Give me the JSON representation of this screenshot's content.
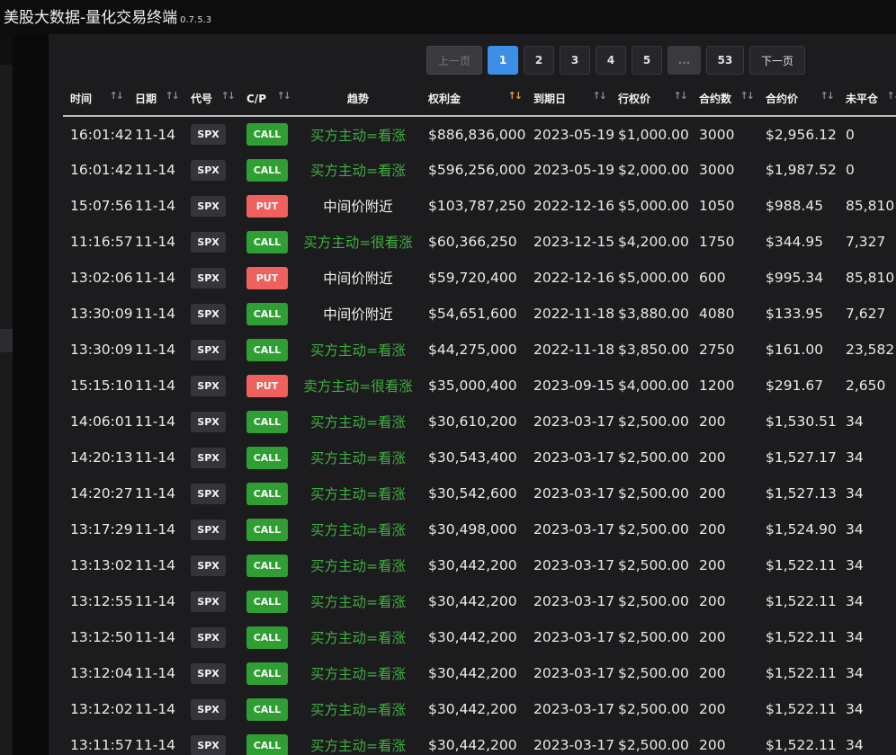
{
  "app": {
    "title": "美股大数据-量化交易终端",
    "version": "0.7.5.3"
  },
  "pagination": {
    "prev_label": "上一页",
    "pages": [
      "1",
      "2",
      "3",
      "4",
      "5"
    ],
    "ellipsis": "...",
    "last_page": "53",
    "next_label": "下一页",
    "current": "1"
  },
  "table": {
    "columns": [
      "时间",
      "日期",
      "代号",
      "C/P",
      "趋势",
      "权利金",
      "到期日",
      "行权价",
      "合约数",
      "合约价",
      "未平仓"
    ],
    "sorted_column": "权利金",
    "rows": [
      [
        "16:01:42",
        "11-14",
        "SPX",
        "CALL",
        "买方主动=看涨",
        "$886,836,000",
        "2023-05-19",
        "$1,000.00",
        "3000",
        "$2,956.12",
        "0"
      ],
      [
        "16:01:42",
        "11-14",
        "SPX",
        "CALL",
        "买方主动=看涨",
        "$596,256,000",
        "2023-05-19",
        "$2,000.00",
        "3000",
        "$1,987.52",
        "0"
      ],
      [
        "15:07:56",
        "11-14",
        "SPX",
        "PUT",
        "中间价附近",
        "$103,787,250",
        "2022-12-16",
        "$5,000.00",
        "1050",
        "$988.45",
        "85,810"
      ],
      [
        "11:16:57",
        "11-14",
        "SPX",
        "CALL",
        "买方主动=很看涨",
        "$60,366,250",
        "2023-12-15",
        "$4,200.00",
        "1750",
        "$344.95",
        "7,327"
      ],
      [
        "13:02:06",
        "11-14",
        "SPX",
        "PUT",
        "中间价附近",
        "$59,720,400",
        "2022-12-16",
        "$5,000.00",
        "600",
        "$995.34",
        "85,810"
      ],
      [
        "13:30:09",
        "11-14",
        "SPX",
        "CALL",
        "中间价附近",
        "$54,651,600",
        "2022-11-18",
        "$3,880.00",
        "4080",
        "$133.95",
        "7,627"
      ],
      [
        "13:30:09",
        "11-14",
        "SPX",
        "CALL",
        "买方主动=看涨",
        "$44,275,000",
        "2022-11-18",
        "$3,850.00",
        "2750",
        "$161.00",
        "23,582"
      ],
      [
        "15:15:10",
        "11-14",
        "SPX",
        "PUT",
        "卖方主动=很看涨",
        "$35,000,400",
        "2023-09-15",
        "$4,000.00",
        "1200",
        "$291.67",
        "2,650"
      ],
      [
        "14:06:01",
        "11-14",
        "SPX",
        "CALL",
        "买方主动=看涨",
        "$30,610,200",
        "2023-03-17",
        "$2,500.00",
        "200",
        "$1,530.51",
        "34"
      ],
      [
        "14:20:13",
        "11-14",
        "SPX",
        "CALL",
        "买方主动=看涨",
        "$30,543,400",
        "2023-03-17",
        "$2,500.00",
        "200",
        "$1,527.17",
        "34"
      ],
      [
        "14:20:27",
        "11-14",
        "SPX",
        "CALL",
        "买方主动=看涨",
        "$30,542,600",
        "2023-03-17",
        "$2,500.00",
        "200",
        "$1,527.13",
        "34"
      ],
      [
        "13:17:29",
        "11-14",
        "SPX",
        "CALL",
        "买方主动=看涨",
        "$30,498,000",
        "2023-03-17",
        "$2,500.00",
        "200",
        "$1,524.90",
        "34"
      ],
      [
        "13:13:02",
        "11-14",
        "SPX",
        "CALL",
        "买方主动=看涨",
        "$30,442,200",
        "2023-03-17",
        "$2,500.00",
        "200",
        "$1,522.11",
        "34"
      ],
      [
        "13:12:55",
        "11-14",
        "SPX",
        "CALL",
        "买方主动=看涨",
        "$30,442,200",
        "2023-03-17",
        "$2,500.00",
        "200",
        "$1,522.11",
        "34"
      ],
      [
        "13:12:50",
        "11-14",
        "SPX",
        "CALL",
        "买方主动=看涨",
        "$30,442,200",
        "2023-03-17",
        "$2,500.00",
        "200",
        "$1,522.11",
        "34"
      ],
      [
        "13:12:04",
        "11-14",
        "SPX",
        "CALL",
        "买方主动=看涨",
        "$30,442,200",
        "2023-03-17",
        "$2,500.00",
        "200",
        "$1,522.11",
        "34"
      ],
      [
        "13:12:02",
        "11-14",
        "SPX",
        "CALL",
        "买方主动=看涨",
        "$30,442,200",
        "2023-03-17",
        "$2,500.00",
        "200",
        "$1,522.11",
        "34"
      ],
      [
        "13:11:57",
        "11-14",
        "SPX",
        "CALL",
        "买方主动=看涨",
        "$30,442,200",
        "2023-03-17",
        "$2,500.00",
        "200",
        "$1,522.11",
        "34"
      ]
    ]
  },
  "colors": {
    "call": "#2f9e33",
    "put": "#f0605c",
    "trend_green": "#3fae3f",
    "active_page": "#3b8fe6",
    "sort_active": "#e6a23c"
  }
}
